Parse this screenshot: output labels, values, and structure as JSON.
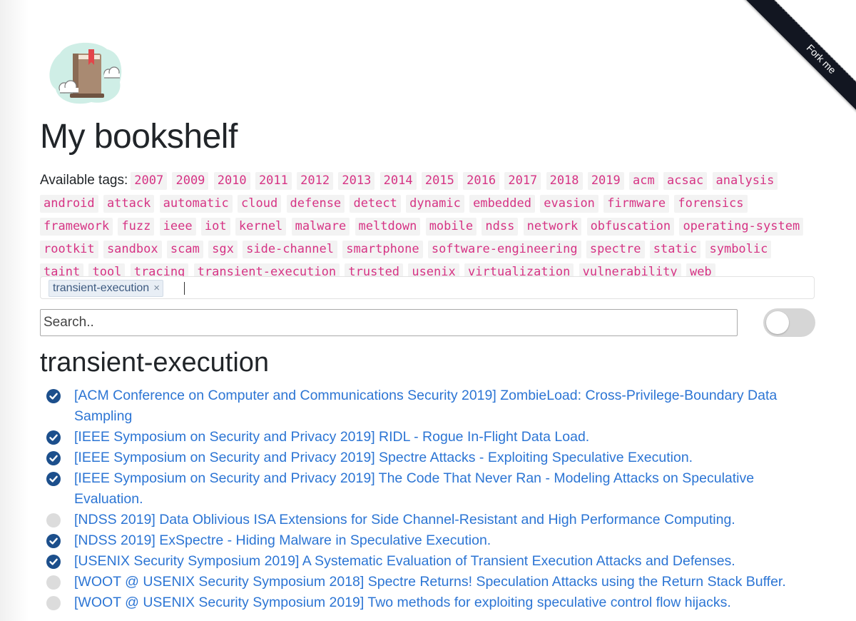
{
  "title": "My bookshelf",
  "tags_label": "Available tags:",
  "tags": [
    "2007",
    "2009",
    "2010",
    "2011",
    "2012",
    "2013",
    "2014",
    "2015",
    "2016",
    "2017",
    "2018",
    "2019",
    "acm",
    "acsac",
    "analysis",
    "android",
    "attack",
    "automatic",
    "cloud",
    "defense",
    "detect",
    "dynamic",
    "embedded",
    "evasion",
    "firmware",
    "forensics",
    "framework",
    "fuzz",
    "ieee",
    "iot",
    "kernel",
    "malware",
    "meltdown",
    "mobile",
    "ndss",
    "network",
    "obfuscation",
    "operating-system",
    "rootkit",
    "sandbox",
    "scam",
    "sgx",
    "side-channel",
    "smartphone",
    "software-engineering",
    "spectre",
    "static",
    "symbolic",
    "taint",
    "tool",
    "tracing",
    "transient-execution",
    "trusted",
    "usenix",
    "virtualization",
    "vulnerability",
    "web"
  ],
  "selected_tags": [
    "transient-execution"
  ],
  "chip_remove_symbol": "×",
  "search": {
    "placeholder": "Search..",
    "value": ""
  },
  "toggle": {
    "on": false
  },
  "section_title": "transient-execution",
  "papers": [
    {
      "title": "[ACM Conference on Computer and Communications Security 2019] ZombieLoad: Cross-Privilege-Boundary Data Sampling",
      "read": true
    },
    {
      "title": "[IEEE Symposium on Security and Privacy 2019] RIDL - Rogue In-Flight Data Load.",
      "read": true
    },
    {
      "title": "[IEEE Symposium on Security and Privacy 2019] Spectre Attacks - Exploiting Speculative Execution.",
      "read": true
    },
    {
      "title": "[IEEE Symposium on Security and Privacy 2019] The Code That Never Ran - Modeling Attacks on Speculative Evaluation.",
      "read": true
    },
    {
      "title": "[NDSS 2019] Data Oblivious ISA Extensions for Side Channel-Resistant and High Performance Computing.",
      "read": false
    },
    {
      "title": "[NDSS 2019] ExSpectre - Hiding Malware in Speculative Execution.",
      "read": true
    },
    {
      "title": "[USENIX Security Symposium 2019] A Systematic Evaluation of Transient Execution Attacks and Defenses.",
      "read": true
    },
    {
      "title": "[WOOT @ USENIX Security Symposium 2018] Spectre Returns! Speculation Attacks using the Return Stack Buffer.",
      "read": false
    },
    {
      "title": "[WOOT @ USENIX Security Symposium 2019] Two methods for exploiting speculative control flow hijacks.",
      "read": false
    }
  ],
  "ribbon_text": "Fork me on GitHub",
  "colors": {
    "tag": "#d63384",
    "link": "#2c75d4",
    "read_icon": "#1c4f8c",
    "unread_icon": "#dcdcdc",
    "ribbon": "#121621"
  }
}
